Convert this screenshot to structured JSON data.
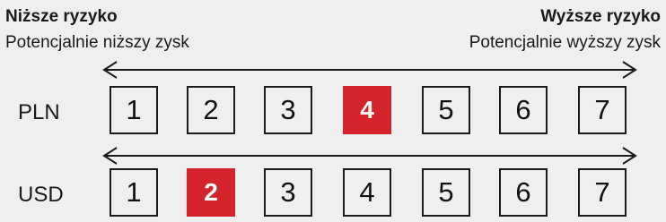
{
  "header": {
    "low_risk": "Niższe ryzyko",
    "high_risk": "Wyższe ryzyko",
    "low_return": "Potencjalnie niższy zysk",
    "high_return": "Potencjalnie wyższy zysk"
  },
  "colors": {
    "background": "#efefef",
    "active": "#d4232b",
    "text": "#1a1a1a"
  },
  "rows": [
    {
      "label": "PLN",
      "active": 4,
      "values": [
        "1",
        "2",
        "3",
        "4",
        "5",
        "6",
        "7"
      ]
    },
    {
      "label": "USD",
      "active": 2,
      "values": [
        "1",
        "2",
        "3",
        "4",
        "5",
        "6",
        "7"
      ]
    }
  ]
}
